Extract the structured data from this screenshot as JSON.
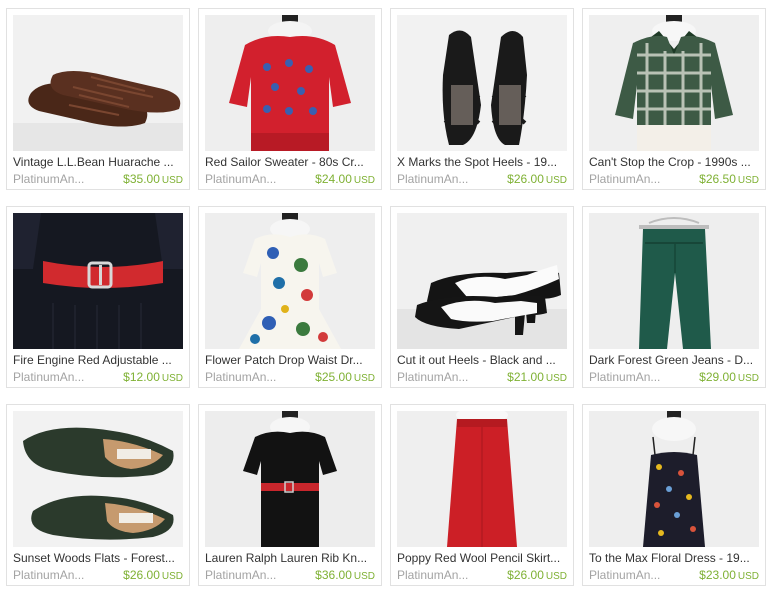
{
  "listings": [
    {
      "title": "Vintage L.L.Bean Huarache ...",
      "shop": "PlatinumAn...",
      "price": "$35.00",
      "currency": "USD",
      "image": "brown-woven-huarache-sandals"
    },
    {
      "title": "Red Sailor Sweater - 80s Cr...",
      "shop": "PlatinumAn...",
      "price": "$24.00",
      "currency": "USD",
      "image": "red-sweater-on-mannequin"
    },
    {
      "title": "X Marks the Spot Heels - 19...",
      "shop": "PlatinumAn...",
      "price": "$26.00",
      "currency": "USD",
      "image": "black-strappy-heels"
    },
    {
      "title": "Can't Stop the Crop - 1990s ...",
      "shop": "PlatinumAn...",
      "price": "$26.50",
      "currency": "USD",
      "image": "plaid-cropped-jacket"
    },
    {
      "title": "Fire Engine Red Adjustable ...",
      "shop": "PlatinumAn...",
      "price": "$12.00",
      "currency": "USD",
      "image": "red-belt-on-black-dress"
    },
    {
      "title": "Flower Patch Drop Waist Dr...",
      "shop": "PlatinumAn...",
      "price": "$25.00",
      "currency": "USD",
      "image": "floral-drop-waist-dress"
    },
    {
      "title": "Cut it out Heels - Black and ...",
      "shop": "PlatinumAn...",
      "price": "$21.00",
      "currency": "USD",
      "image": "black-white-cutout-heels"
    },
    {
      "title": "Dark Forest Green Jeans - D...",
      "shop": "PlatinumAn...",
      "price": "$29.00",
      "currency": "USD",
      "image": "green-jeans-on-hanger"
    },
    {
      "title": "Sunset Woods Flats - Forest...",
      "shop": "PlatinumAn...",
      "price": "$26.00",
      "currency": "USD",
      "image": "green-leather-flats"
    },
    {
      "title": "Lauren Ralph Lauren Rib Kn...",
      "shop": "PlatinumAn...",
      "price": "$36.00",
      "currency": "USD",
      "image": "black-knit-dress-red-belt"
    },
    {
      "title": "Poppy Red Wool Pencil Skirt...",
      "shop": "PlatinumAn...",
      "price": "$26.00",
      "currency": "USD",
      "image": "red-pencil-skirt"
    },
    {
      "title": "To the Max Floral Dress - 19...",
      "shop": "PlatinumAn...",
      "price": "$23.00",
      "currency": "USD",
      "image": "dark-floral-slip-dress"
    }
  ],
  "colors": {
    "title": "#333333",
    "shop": "#a3a3a3",
    "price": "#7fb134",
    "border": "#e1e1e1"
  }
}
